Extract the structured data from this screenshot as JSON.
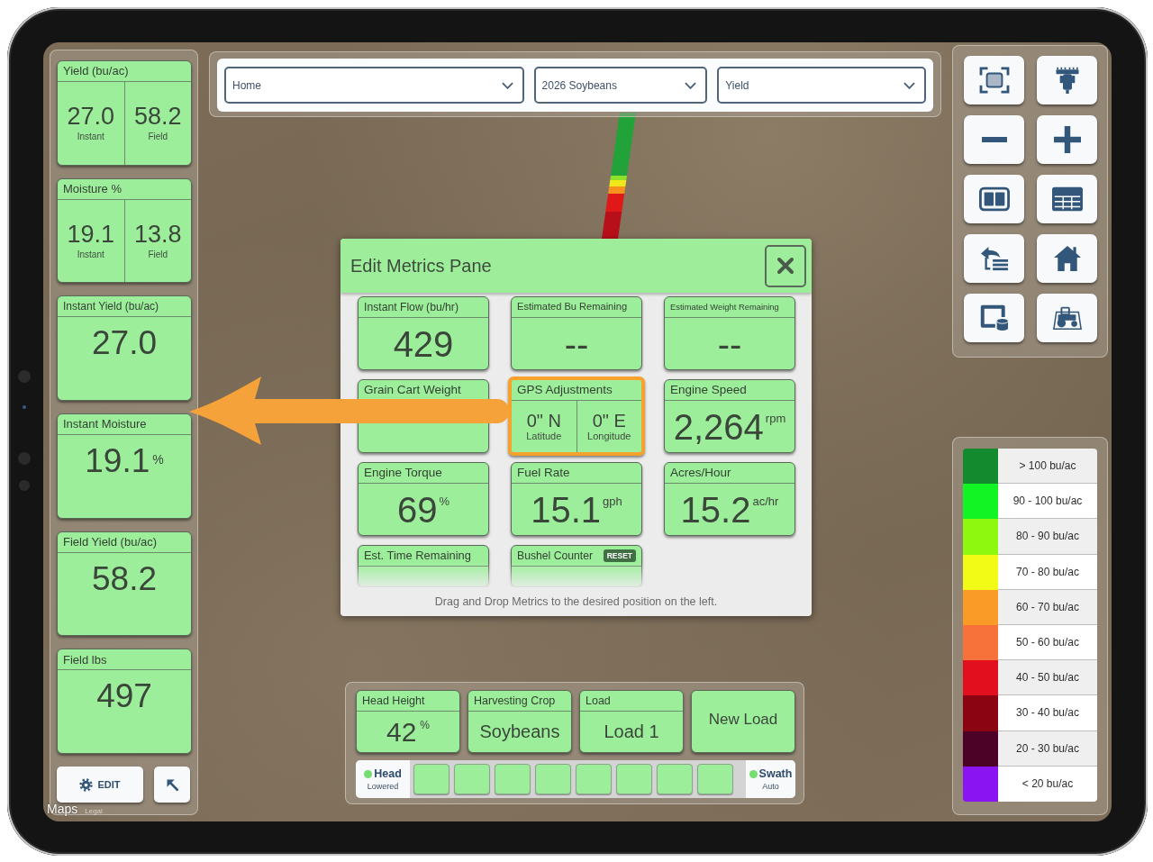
{
  "left_panel": {
    "metrics": [
      {
        "kind": "split",
        "title": "Yield (bu/ac)",
        "parts": [
          {
            "value": "27.0",
            "label": "Instant"
          },
          {
            "value": "58.2",
            "label": "Field"
          }
        ]
      },
      {
        "kind": "split",
        "title": "Moisture %",
        "parts": [
          {
            "value": "19.1",
            "label": "Instant"
          },
          {
            "value": "13.8",
            "label": "Field"
          }
        ]
      },
      {
        "kind": "single",
        "title": "Instant Yield (bu/ac)",
        "value": "27.0"
      },
      {
        "kind": "single",
        "title": "Instant Moisture",
        "value": "19.1",
        "unit": "%"
      },
      {
        "kind": "single",
        "title": "Field Yield (bu/ac)",
        "value": "58.2"
      },
      {
        "kind": "single",
        "title": "Field lbs",
        "value": "497"
      }
    ],
    "edit_button": "EDIT"
  },
  "map": {
    "attribution": "Maps",
    "legal": "Legal"
  },
  "top_bar": {
    "dropdowns": [
      {
        "value": "Home"
      },
      {
        "value": "2026 Soybeans"
      },
      {
        "value": "Yield"
      }
    ]
  },
  "legend": [
    {
      "label": "> 100 bu/ac",
      "color": "#138a2e"
    },
    {
      "label": "90 - 100 bu/ac",
      "color": "#12f424"
    },
    {
      "label": "80 - 90 bu/ac",
      "color": "#8ef80f"
    },
    {
      "label": "70 - 80 bu/ac",
      "color": "#f2fb16"
    },
    {
      "label": "60 - 70 bu/ac",
      "color": "#f99b26"
    },
    {
      "label": "50 - 60 bu/ac",
      "color": "#f7723a"
    },
    {
      "label": "40 - 50 bu/ac",
      "color": "#e2101f"
    },
    {
      "label": "30 - 40 bu/ac",
      "color": "#8a0412"
    },
    {
      "label": "20 - 30 bu/ac",
      "color": "#4c0226"
    },
    {
      "label": "< 20 bu/ac",
      "color": "#8a14f2"
    }
  ],
  "modal": {
    "title": "Edit Metrics Pane",
    "metrics": [
      {
        "kind": "single",
        "title": "Instant Flow (bu/hr)",
        "value": "429",
        "selected": false
      },
      {
        "kind": "single",
        "title": "Estimated Bu Remaining",
        "value": "--",
        "selected": false
      },
      {
        "kind": "single",
        "title": "Estimated Weight Remaining",
        "value": "--",
        "selected": false
      },
      {
        "kind": "single",
        "title": "Grain Cart Weight",
        "selected": false
      },
      {
        "kind": "split",
        "title": "GPS Adjustments",
        "parts": [
          {
            "value": "0\" N",
            "label": "Latitude"
          },
          {
            "value": "0\" E",
            "label": "Longitude"
          }
        ],
        "selected": true
      },
      {
        "kind": "single",
        "title": "Engine Speed",
        "value": "2,264",
        "unit": "rpm",
        "selected": false
      },
      {
        "kind": "single",
        "title": "Engine Torque",
        "value": "69",
        "unit": "%",
        "selected": false
      },
      {
        "kind": "single",
        "title": "Fuel Rate",
        "value": "15.1",
        "unit": "gph",
        "selected": false
      },
      {
        "kind": "single",
        "title": "Acres/Hour",
        "value": "15.2",
        "unit": "ac/hr",
        "selected": false
      },
      {
        "kind": "single",
        "title": "Est. Time Remaining",
        "selected": false
      },
      {
        "kind": "single",
        "title": "Bushel Counter",
        "badge": "RESET",
        "selected": false
      }
    ],
    "footer": "Drag and Drop Metrics to the desired position on the left."
  },
  "bottom_bar": {
    "metrics": [
      {
        "kind": "number",
        "title": "Head Height",
        "value": "42",
        "unit": "%"
      },
      {
        "kind": "text",
        "title": "Harvesting Crop",
        "value": "Soybeans"
      },
      {
        "kind": "text",
        "title": "Load",
        "value": "Load 1"
      }
    ],
    "new_load_button": "New Load",
    "head_status": {
      "label": "Head",
      "state": "Lowered",
      "on": true
    },
    "sections": [
      {
        "on": true
      },
      {
        "on": true
      },
      {
        "on": true
      },
      {
        "on": true
      },
      {
        "on": true
      },
      {
        "on": true
      },
      {
        "on": true
      },
      {
        "on": true
      }
    ],
    "swath_status": {
      "label": "Swath",
      "state": "Auto",
      "on": true
    }
  }
}
